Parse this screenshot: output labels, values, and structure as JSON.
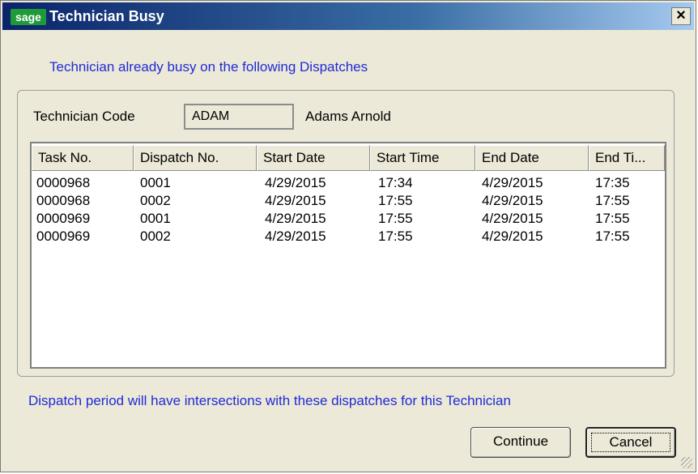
{
  "window": {
    "logo_text": "sage",
    "title": "Technician Busy",
    "close_label": "×"
  },
  "info_top": "Technician already busy on the following Dispatches",
  "technician": {
    "label": "Technician Code",
    "code": "ADAM",
    "name": "Adams Arnold"
  },
  "table": {
    "columns": [
      "Task No.",
      "Dispatch No.",
      "Start Date",
      "Start Time",
      "End Date",
      "End Ti..."
    ],
    "rows": [
      [
        "0000968",
        "0001",
        "4/29/2015",
        "17:34",
        "4/29/2015",
        "17:35"
      ],
      [
        "0000968",
        "0002",
        "4/29/2015",
        "17:55",
        "4/29/2015",
        "17:55"
      ],
      [
        "0000969",
        "0001",
        "4/29/2015",
        "17:55",
        "4/29/2015",
        "17:55"
      ],
      [
        "0000969",
        "0002",
        "4/29/2015",
        "17:55",
        "4/29/2015",
        "17:55"
      ]
    ]
  },
  "info_bottom": "Dispatch period will have intersections with these dispatches for this Technician",
  "buttons": {
    "continue": "Continue",
    "cancel": "Cancel"
  }
}
